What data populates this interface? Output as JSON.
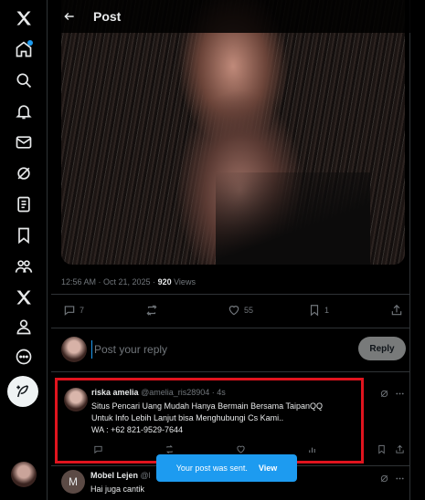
{
  "nav": {
    "items": [
      {
        "name": "x-logo-icon"
      },
      {
        "name": "home-icon",
        "badge": true
      },
      {
        "name": "search-icon"
      },
      {
        "name": "bell-icon"
      },
      {
        "name": "mail-icon"
      },
      {
        "name": "grok-icon"
      },
      {
        "name": "lists-icon"
      },
      {
        "name": "bookmark-icon"
      },
      {
        "name": "communities-icon"
      },
      {
        "name": "premium-x-icon"
      },
      {
        "name": "profile-icon"
      },
      {
        "name": "more-icon"
      }
    ],
    "post_button_icon": "feather-plus-icon"
  },
  "header": {
    "title": "Post"
  },
  "post": {
    "time": "12:56 AM · Oct 21, 2025 · ",
    "views_count": "920",
    "views_label": " Views",
    "replies": "7",
    "likes": "55",
    "bookmarks": "1"
  },
  "composer": {
    "placeholder": "Post your reply",
    "button": "Reply"
  },
  "reply1": {
    "name": "riska amelia",
    "handle": "@amelia_ris28904 · 4s",
    "lines": [
      "Situs Pencari Uang Mudah Hanya Bermain Bersama TaipanQQ",
      "Untuk Info Lebih Lanjut bisa Menghubungi Cs Kami..",
      "WA : +62 821-9529-7644"
    ]
  },
  "reply2": {
    "avatar_letter": "M",
    "name": "Mobel Lejen",
    "handle": "@l",
    "text": "Hai juga cantik"
  },
  "toast": {
    "message": "Your post was sent.",
    "action": "View"
  },
  "colors": {
    "accent": "#1d9bf0",
    "highlight_border": "#e0141e",
    "muted": "#71767b"
  }
}
